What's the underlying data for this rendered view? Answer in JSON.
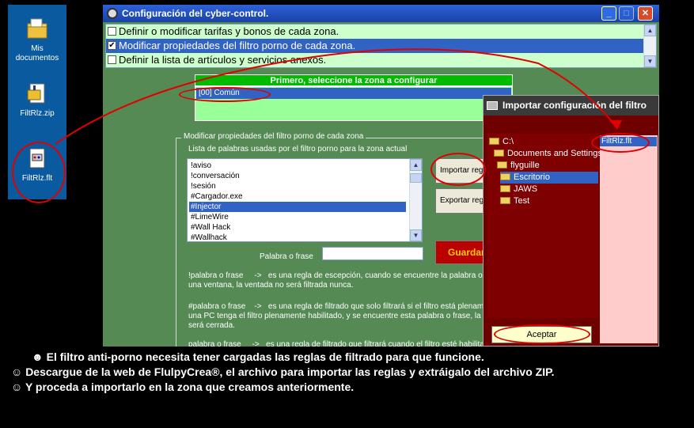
{
  "desktop": {
    "icons": [
      {
        "label_line1": "Mis",
        "label_line2": "documentos",
        "icon": "my-documents-icon"
      },
      {
        "label_line1": "FiltRlz.zip",
        "label_line2": "",
        "icon": "zip-archive-icon"
      },
      {
        "label_line1": "FiltRlz.flt",
        "label_line2": "",
        "icon": "flt-file-icon"
      }
    ]
  },
  "window": {
    "title": "Configuración del cyber-control.",
    "options": [
      {
        "label": "Definir o modificar tarifas y bonos de cada zona.",
        "checked": false,
        "selected": false
      },
      {
        "label": "Modificar propiedades del filtro porno de cada zona.",
        "checked": true,
        "selected": true
      },
      {
        "label": "Definir la lista de artículos y servicios anexos.",
        "checked": false,
        "selected": false
      }
    ],
    "zone_header": "Primero, seleccione la zona a configurar",
    "zones": [
      "[00] Común"
    ],
    "group_label": "Modificar propiedades del filtro porno de cada zona",
    "list_label": "Lista de palabras usadas por el filtro porno para la zona actual",
    "words": [
      "!aviso",
      "!conversación",
      "!sesión",
      "#Cargador.exe",
      "#Injector",
      "#LimeWire",
      "#Wall Hack",
      "#Wallhack"
    ],
    "selected_word": "#Injector",
    "import_button": "Importar reglas",
    "export_button": "Exportar reglas",
    "save_button": "Guardar",
    "phrase_label": "Palabra o frase",
    "phrase_value": "",
    "help": [
      "!palabra o frase     ->   es una regla de escepción, cuando se encuentre la palabra o frase en",
      "una ventana, la ventada no será filtrada nunca.",
      "#palabra o frase    ->   es una regla de filtrado que solo filtrará si el filtro está plenamente",
      "una PC tenga el filtro plenamente habilitado, y se encuentre esta palabra o frase, la ventana",
      "será cerrada.",
      "palabra o frase     ->   es una regla de filtrado que filtrará cuando el filtro esté habilitado"
    ]
  },
  "import_dialog": {
    "title": "Importar configuración del filtro",
    "dirs": [
      {
        "label": "C:\\",
        "selected": false
      },
      {
        "label": "Documents and Settings",
        "selected": false
      },
      {
        "label": "flyguille",
        "selected": false
      },
      {
        "label": "Escritorio",
        "selected": true
      },
      {
        "label": "JAWS",
        "selected": false
      },
      {
        "label": "Test",
        "selected": false
      }
    ],
    "files": [
      "FiltRlz.flt"
    ],
    "accept_button": "Aceptar"
  },
  "instructions": [
    {
      "icon": "☻",
      "text": "El filtro anti-porno necesita tener cargadas las reglas de filtrado para que funcione."
    },
    {
      "icon": "☺",
      "text": "Descargue de la web de FlulpyCrea®, el archivo para importar las reglas y extráigalo del archivo ZIP."
    },
    {
      "icon": "☺",
      "text": "Y proceda a importarlo en la zona que creamos anteriormente."
    }
  ],
  "colors": {
    "annotation": "#e00000",
    "selection": "#3163c5",
    "window_bg": "#558a55"
  }
}
